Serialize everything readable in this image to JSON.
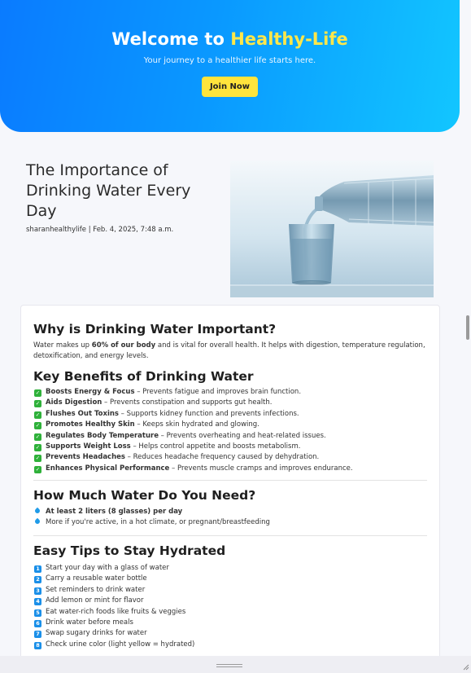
{
  "hero": {
    "title_prefix": "Welcome to ",
    "title_accent": "Healthy-Life",
    "tagline": "Your journey to a healthier life starts here.",
    "cta_label": "Join Now"
  },
  "post": {
    "title": "The Importance of Drinking Water Every Day",
    "meta": "sharanhealthylife | Feb. 4, 2025, 7:48 a.m."
  },
  "why": {
    "heading": "Why is Drinking Water Important?",
    "text_before": "Water makes up ",
    "text_bold": "60% of our body",
    "text_after": " and is vital for overall health. It helps with digestion, temperature regulation, detoxification, and energy levels."
  },
  "benefits": {
    "heading": "Key Benefits of Drinking Water",
    "items": [
      {
        "title": "Boosts Energy & Focus",
        "desc": " – Prevents fatigue and improves brain function."
      },
      {
        "title": "Aids Digestion",
        "desc": " – Prevents constipation and supports gut health."
      },
      {
        "title": "Flushes Out Toxins",
        "desc": " – Supports kidney function and prevents infections."
      },
      {
        "title": "Promotes Healthy Skin",
        "desc": " – Keeps skin hydrated and glowing."
      },
      {
        "title": "Regulates Body Temperature",
        "desc": " – Prevents overheating and heat-related issues."
      },
      {
        "title": "Supports Weight Loss",
        "desc": " – Helps control appetite and boosts metabolism."
      },
      {
        "title": "Prevents Headaches",
        "desc": " – Reduces headache frequency caused by dehydration."
      },
      {
        "title": "Enhances Physical Performance",
        "desc": " – Prevents muscle cramps and improves endurance."
      }
    ]
  },
  "amount": {
    "heading": "How Much Water Do You Need?",
    "items": [
      {
        "text": "At least 2 liters (8 glasses) per day",
        "bold": true
      },
      {
        "text": "More if you're active, in a hot climate, or pregnant/breastfeeding",
        "bold": false
      }
    ]
  },
  "tips": {
    "heading": "Easy Tips to Stay Hydrated",
    "items": [
      {
        "num": "1",
        "text": "Start your day with a glass of water"
      },
      {
        "num": "2",
        "text": "Carry a reusable water bottle"
      },
      {
        "num": "3",
        "text": "Set reminders to drink water"
      },
      {
        "num": "4",
        "text": "Add lemon or mint for flavor"
      },
      {
        "num": "5",
        "text": "Eat water-rich foods like fruits & veggies"
      },
      {
        "num": "6",
        "text": "Drink water before meals"
      },
      {
        "num": "7",
        "text": "Swap sugary drinks for water"
      },
      {
        "num": "8",
        "text": "Check urine color (light yellow = hydrated)"
      }
    ]
  },
  "colors": {
    "hero_gradient_start": "#0a7bff",
    "hero_gradient_end": "#12c6ff",
    "accent_yellow": "#ffe43c",
    "check_green": "#2fb13a",
    "number_blue": "#1a8fe8"
  }
}
